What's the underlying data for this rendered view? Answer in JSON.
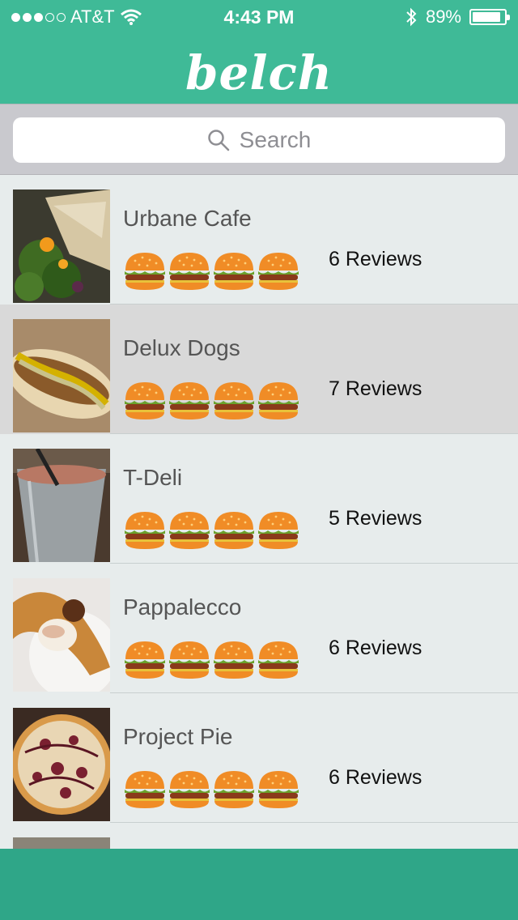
{
  "status_bar": {
    "carrier": "AT&T",
    "signal_bars_filled": 3,
    "signal_bars_total": 5,
    "time": "4:43 PM",
    "battery_percent": "89%",
    "battery_level": 0.89
  },
  "app": {
    "title": "belch",
    "brand_color": "#3fba97"
  },
  "search": {
    "placeholder": "Search"
  },
  "restaurants": [
    {
      "name": "Urbane Cafe",
      "reviews": "6 Reviews",
      "burgers": 4,
      "highlighted": false,
      "thumb": "salad-wrap-photo"
    },
    {
      "name": "Delux Dogs",
      "reviews": "7 Reviews",
      "burgers": 4,
      "highlighted": true,
      "thumb": "hot-dog-photo"
    },
    {
      "name": "T-Deli",
      "reviews": "5 Reviews",
      "burgers": 4,
      "highlighted": false,
      "thumb": "iced-drink-photo"
    },
    {
      "name": "Pappalecco",
      "reviews": "6 Reviews",
      "burgers": 4,
      "highlighted": false,
      "thumb": "croissant-gelato-photo"
    },
    {
      "name": "Project Pie",
      "reviews": "6 Reviews",
      "burgers": 4,
      "highlighted": false,
      "thumb": "pizza-photo"
    }
  ]
}
